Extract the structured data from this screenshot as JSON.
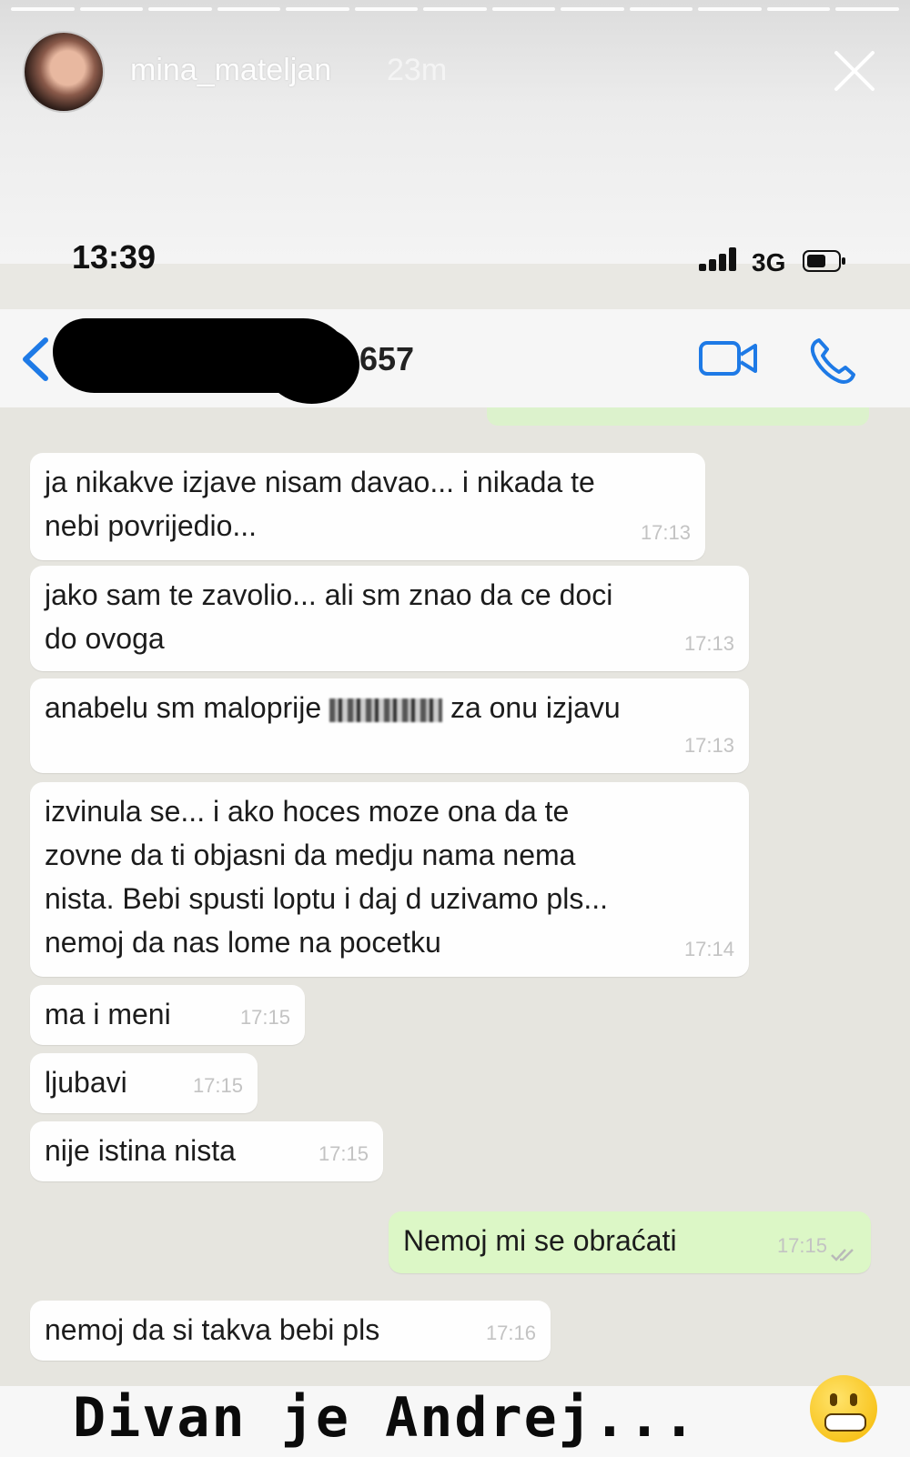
{
  "story": {
    "username": "mina_mateljan",
    "time_ago": "23m",
    "caption": "Divan je Andrej..."
  },
  "status_bar": {
    "time": "13:39",
    "network": "3G"
  },
  "chat_header": {
    "contact_name_visible": "657"
  },
  "messages": [
    {
      "direction": "in",
      "text": "ja nikakve izjave nisam davao... i nikada te\nnebi povrijedio...",
      "time": "17:13"
    },
    {
      "direction": "in",
      "text": "jako sam te zavolio... ali sm znao da ce doci\ndo ovoga",
      "time": "17:13"
    },
    {
      "direction": "in",
      "text_before": "anabelu sm maloprije",
      "text_after": "za onu izjavu",
      "time": "17:13"
    },
    {
      "direction": "in",
      "text": "izvinula se... i ako hoces moze ona da te\nzovne da ti objasni da medju nama nema\nnista. Bebi spusti loptu i daj d uzivamo pls...\nnemoj da nas lome na pocetku",
      "time": "17:14"
    },
    {
      "direction": "in",
      "text": "ma i meni",
      "time": "17:15"
    },
    {
      "direction": "in",
      "text": "ljubavi",
      "time": "17:15"
    },
    {
      "direction": "in",
      "text": "nije istina nista",
      "time": "17:15"
    },
    {
      "direction": "out",
      "text": "Nemoj mi se obraćati",
      "time": "17:15"
    },
    {
      "direction": "in",
      "text": "nemoj da si takva bebi pls",
      "time": "17:16"
    }
  ],
  "icons": {
    "close": "close-icon",
    "signal": "signal-icon",
    "battery": "battery-icon",
    "back": "chevron-left-icon",
    "video": "video-call-icon",
    "phone": "phone-icon",
    "emoji": "grimacing-face-icon"
  },
  "colors": {
    "accent": "#1e7ae6",
    "outgoing_bubble": "#dcf7c6",
    "incoming_bubble": "#fefefe"
  }
}
